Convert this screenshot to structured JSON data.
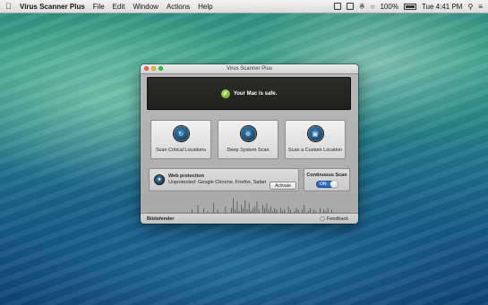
{
  "menubar": {
    "app_name": "Virus Scanner Plus",
    "menus": [
      "File",
      "Edit",
      "Window",
      "Actions",
      "Help"
    ],
    "battery_percent": "100%",
    "clock": "Tue 4:41 PM"
  },
  "window": {
    "title": "Virus Scanner Plus",
    "status_message": "Your Mac is safe.",
    "scan_buttons": [
      {
        "label": "Scan Critical Locations",
        "icon": "radar-icon"
      },
      {
        "label": "Deep System Scan",
        "icon": "crosshair-icon"
      },
      {
        "label": "Scan a Custom Location",
        "icon": "folder-icon"
      }
    ],
    "web_protection": {
      "title": "Web protection",
      "subtitle": "Unprotected: Google Chrome, Firefox, Safari",
      "activate_label": "Activate"
    },
    "continuous_scan": {
      "title": "Continuous Scan",
      "toggle_label": "ON"
    },
    "activity_levels": [
      0.2,
      0,
      0,
      0.5,
      0,
      0,
      0.3,
      0,
      0.1,
      0,
      0,
      0.6,
      0,
      0.2,
      0,
      0,
      0,
      0.4,
      0,
      0,
      0.3,
      0.9,
      0.2,
      0.7,
      0.1,
      0.5,
      0.3,
      0.8,
      0.2,
      0.6,
      0.1,
      0.3,
      0.4,
      0.7,
      0.2,
      0,
      0.5,
      0.3,
      0.6,
      0.2,
      0.4,
      0.1,
      0.3,
      0.2,
      0,
      0.3,
      0.1,
      0.2,
      0,
      0.4,
      0.2,
      0,
      0.1,
      0.3,
      0.2,
      0,
      0.2,
      0.5,
      0,
      0.1,
      0.3,
      0,
      0.2,
      0.1,
      0,
      0.3,
      0,
      0.2,
      0.1,
      0.3,
      0,
      0.2
    ],
    "brand": "Bitdefender",
    "feedback_label": "Feedback"
  },
  "colors": {
    "status_bg": "#23241f",
    "check_green": "#6aa628",
    "toggle_blue": "#3371c9"
  }
}
